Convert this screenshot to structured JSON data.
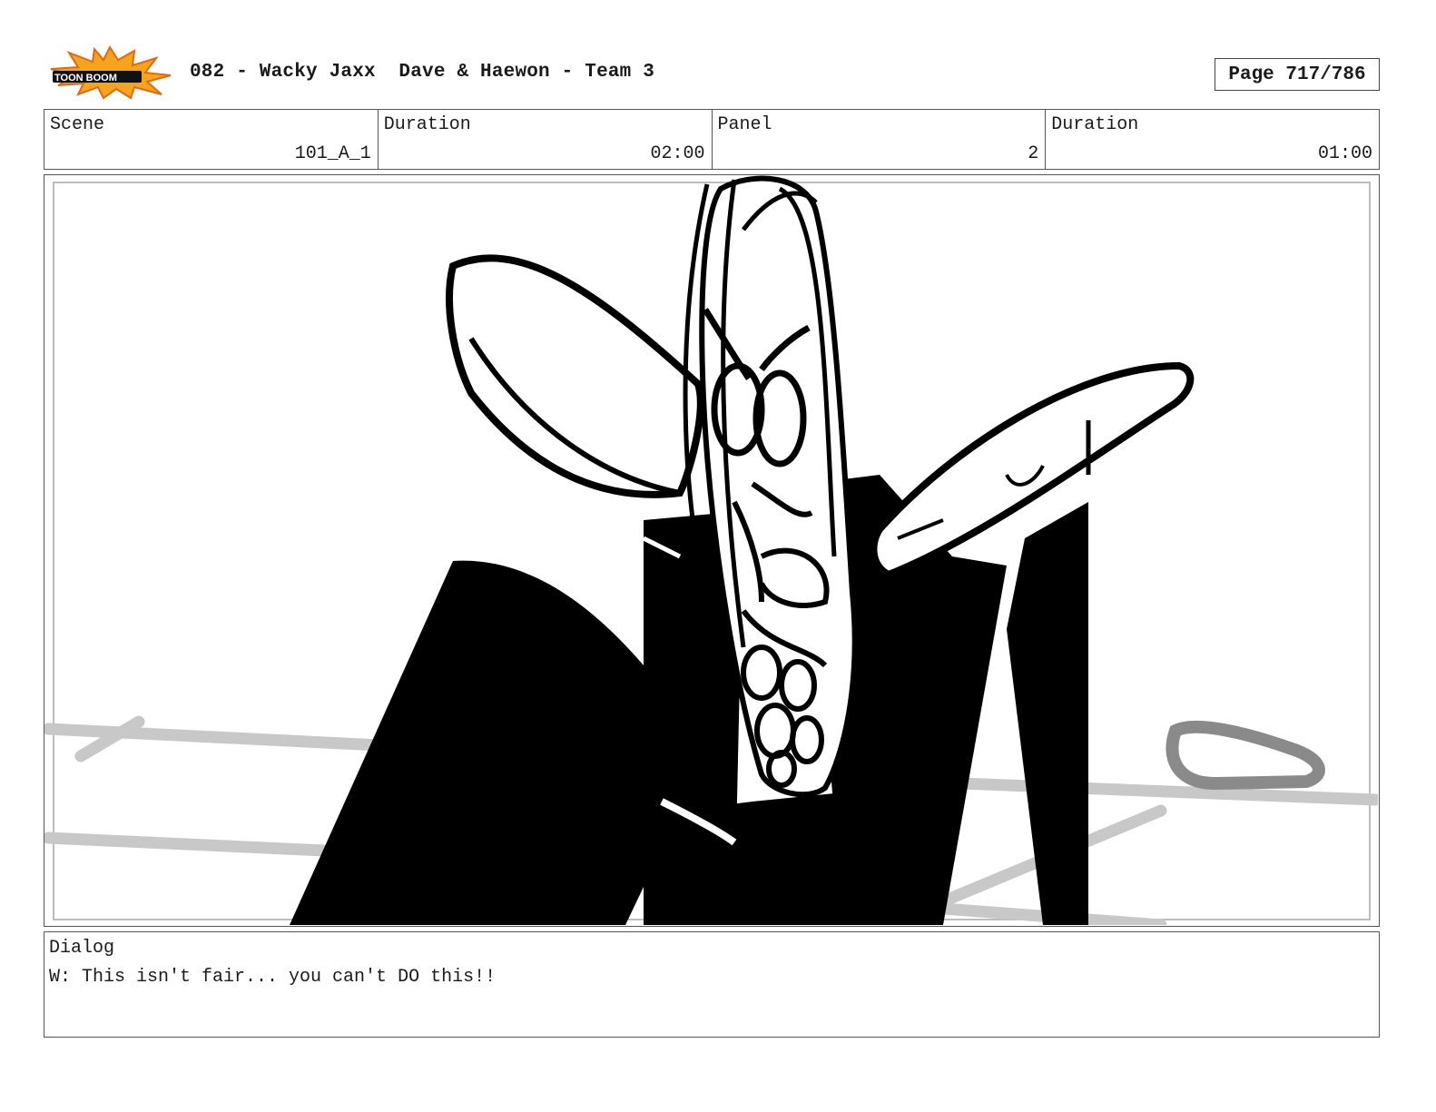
{
  "header": {
    "logo_text": "TOON BOOM",
    "title": "082 - Wacky Jaxx  Dave & Haewon - Team 3",
    "page": "Page 717/786"
  },
  "info": {
    "scene_label": "Scene",
    "scene_value": "101_A_1",
    "scene_duration_label": "Duration",
    "scene_duration_value": "02:00",
    "panel_label": "Panel",
    "panel_value": "2",
    "panel_duration_label": "Duration",
    "panel_duration_value": "01:00"
  },
  "panel": {
    "image_icon": "storyboard-sketch-icon"
  },
  "dialog": {
    "label": "Dialog",
    "text": "W: This isn't fair... you can't DO this!!"
  }
}
